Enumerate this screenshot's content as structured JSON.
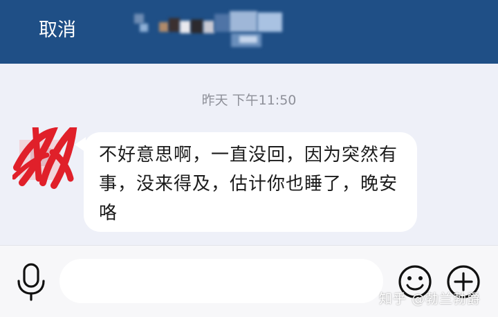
{
  "header": {
    "cancel_label": "取消"
  },
  "chat": {
    "timestamp": "昨天 下午11:50",
    "messages": [
      {
        "text": "不好意思啊，一直没回，因为突然有事，没来得及，估计你也睡了，晚安咯"
      }
    ]
  },
  "input": {
    "value": "",
    "placeholder": ""
  },
  "icons": {
    "voice": "microphone-icon",
    "emoji": "emoji-icon",
    "more": "plus-icon"
  },
  "watermark": {
    "text": "知乎 @勃兰勃爵"
  },
  "colors": {
    "header_bg": "#1f4f86",
    "chat_bg": "#eef0f8",
    "bubble_bg": "#ffffff",
    "redaction": "#e0202a"
  }
}
